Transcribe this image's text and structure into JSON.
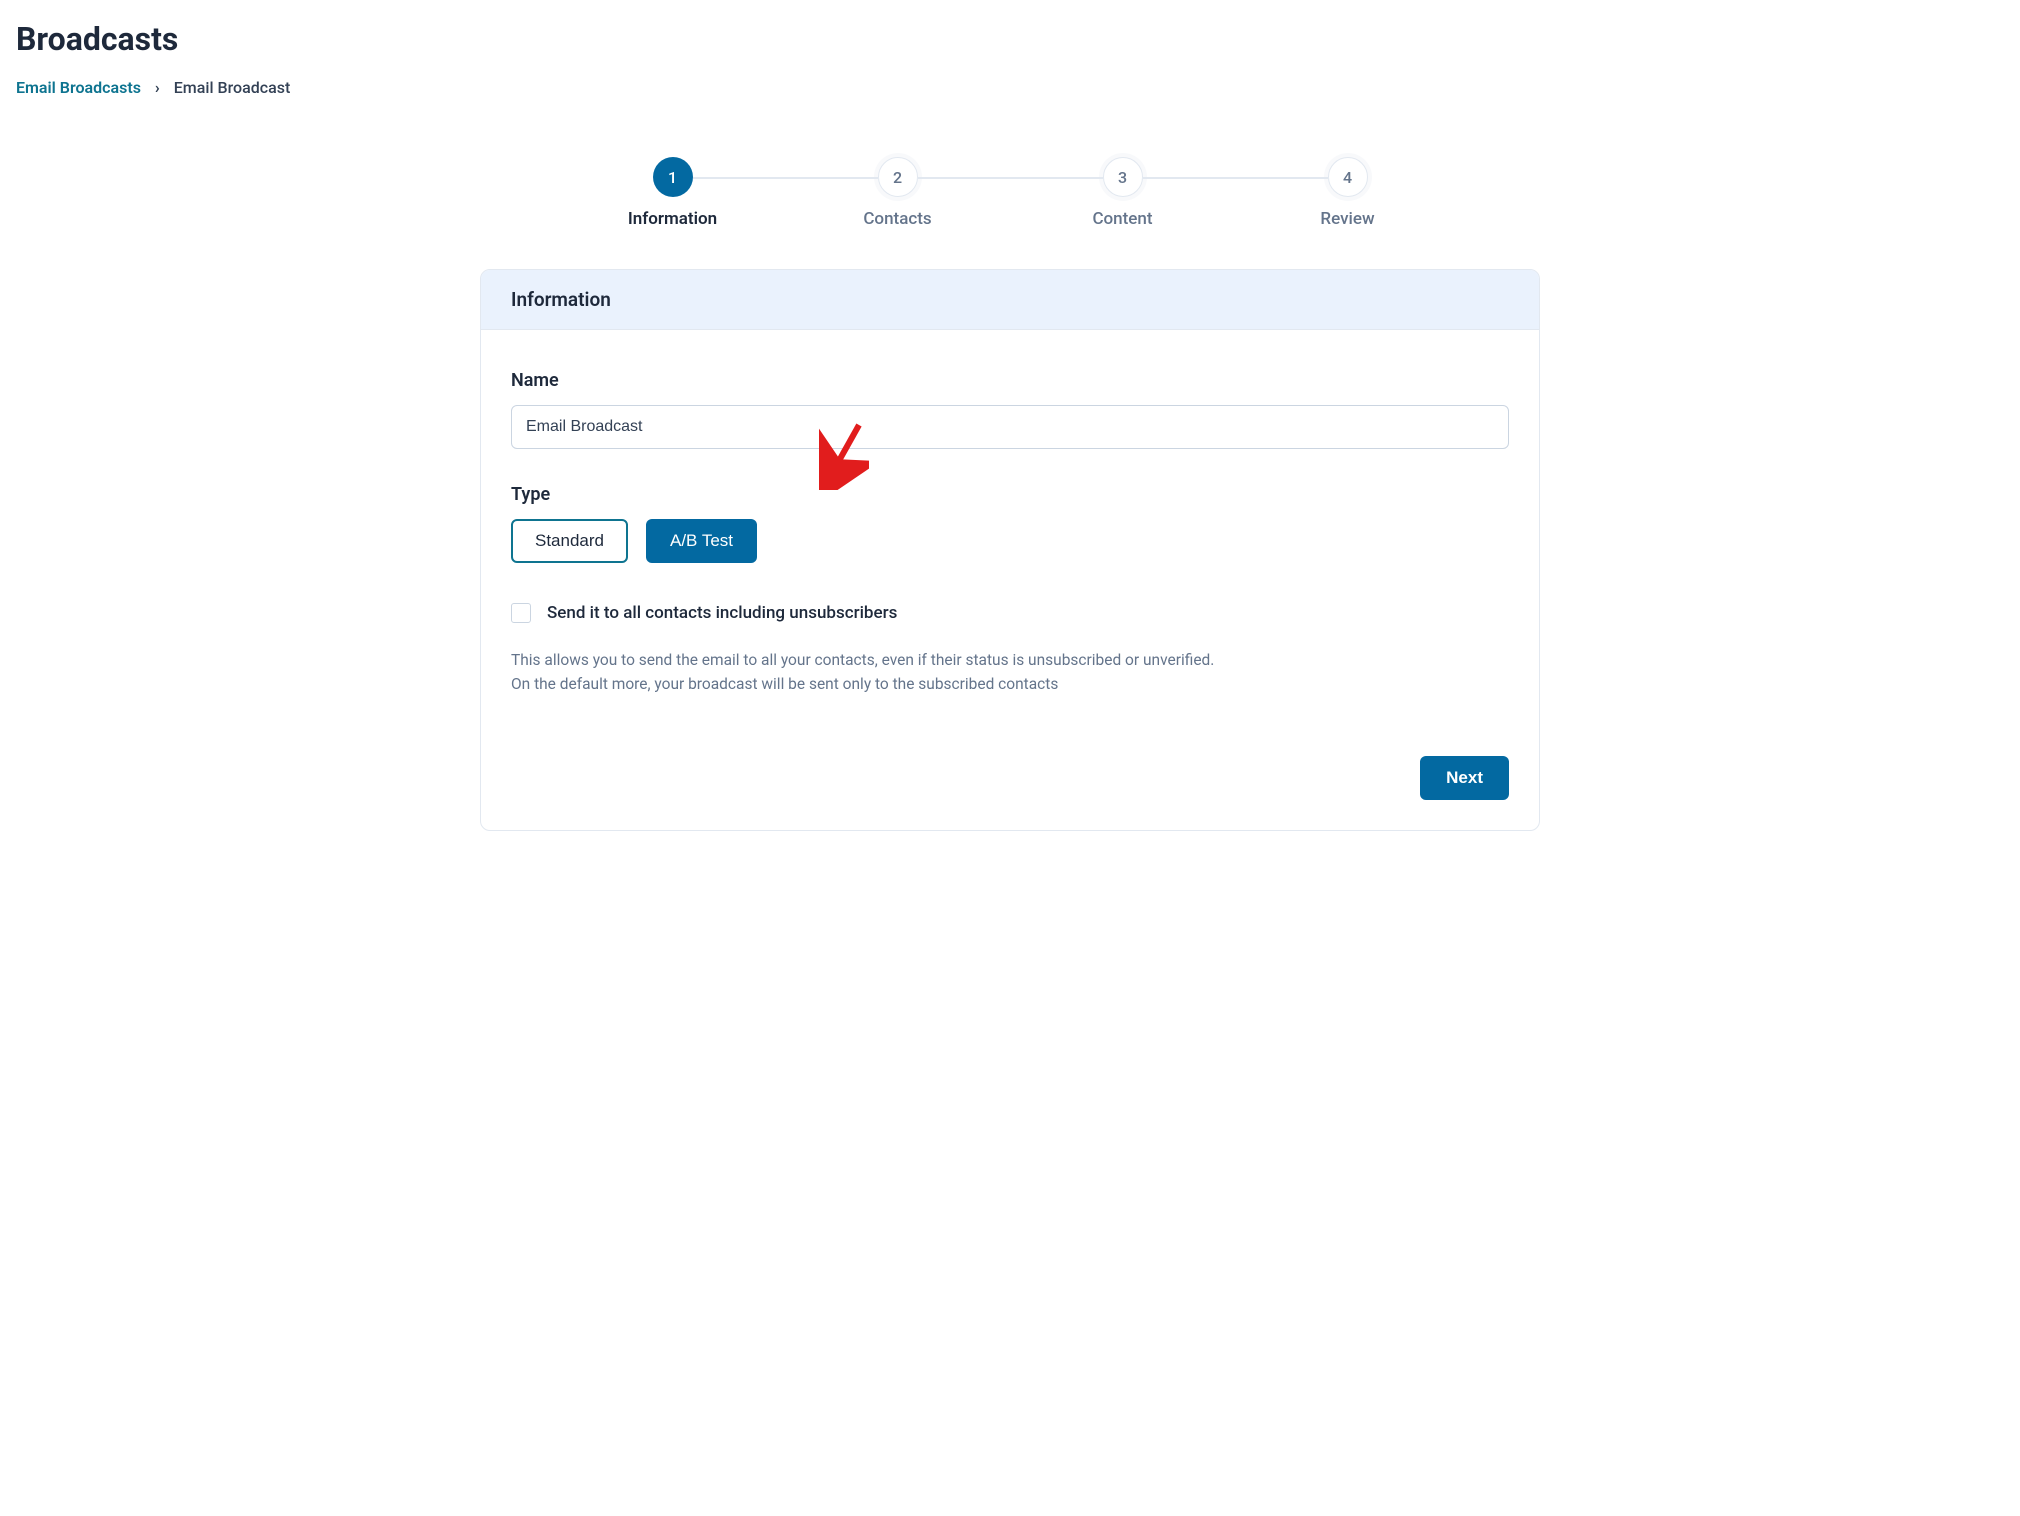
{
  "page": {
    "title": "Broadcasts"
  },
  "breadcrumb": {
    "parent": "Email Broadcasts",
    "current": "Email Broadcast"
  },
  "stepper": {
    "steps": [
      {
        "num": "1",
        "label": "Information"
      },
      {
        "num": "2",
        "label": "Contacts"
      },
      {
        "num": "3",
        "label": "Content"
      },
      {
        "num": "4",
        "label": "Review"
      }
    ]
  },
  "card": {
    "header": "Information",
    "name_label": "Name",
    "name_value": "Email Broadcast",
    "type_label": "Type",
    "type_standard": "Standard",
    "type_abtest": "A/B Test",
    "checkbox_label": "Send it to all contacts including unsubscribers",
    "helper_line1": "This allows you to send the email to all your contacts, even if their status is unsubscribed or unverified.",
    "helper_line2": "On the default more, your broadcast will be sent only to the subscribed contacts",
    "next_label": "Next"
  }
}
